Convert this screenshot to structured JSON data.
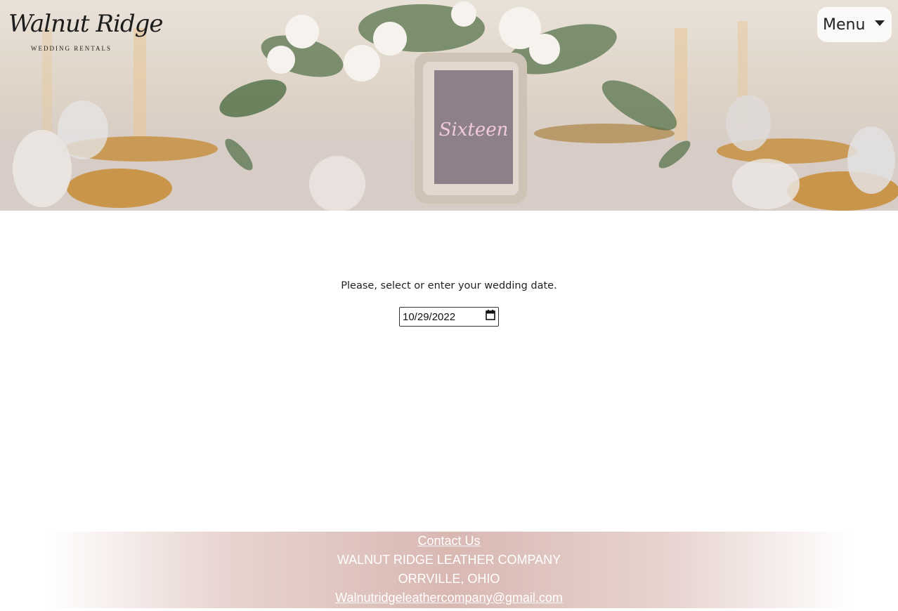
{
  "header": {
    "logo": {
      "script_text": "Walnut Ridge",
      "sub_text": "WEDDING RENTALS"
    },
    "menu_label": "Menu",
    "hero": {
      "table_card_text": "Sixteen"
    }
  },
  "main": {
    "prompt": "Please, select or enter your wedding date.",
    "date_value": "10/29/2022"
  },
  "footer": {
    "contact_link": "Contact Us",
    "company": "WALNUT RIDGE LEATHER COMPANY",
    "location": "ORRVILLE, OHIO",
    "email": "Walnutridgeleathercompany@gmail.com"
  },
  "icons": {
    "menu_caret": "caret-down-icon",
    "calendar": "calendar-icon"
  },
  "colors": {
    "footer_accent": "#d9b8b2",
    "text": "#222222"
  }
}
